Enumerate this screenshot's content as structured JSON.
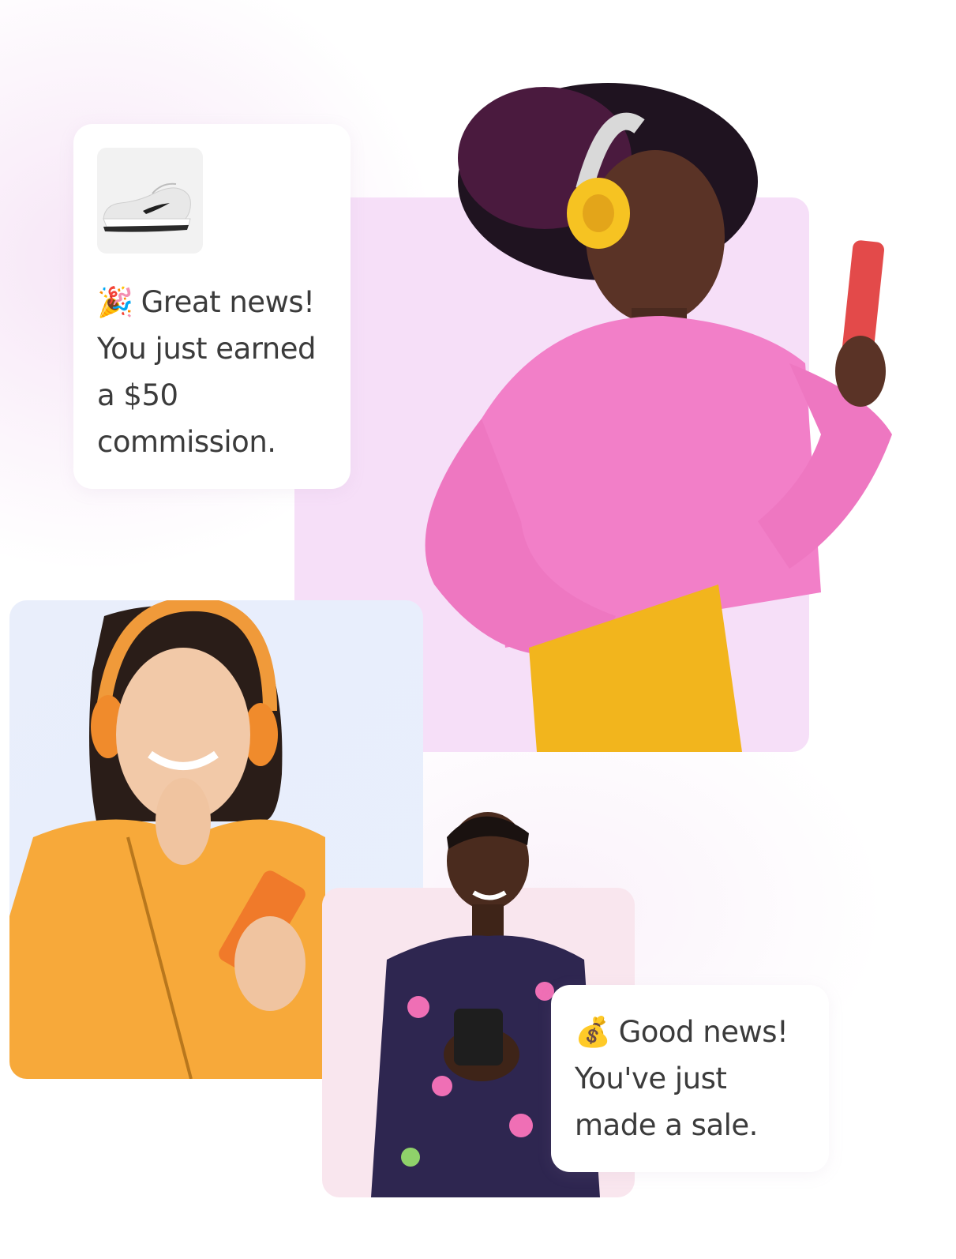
{
  "notifications": {
    "commission": {
      "emoji": "🎉",
      "headline": "Great news!",
      "body_line_1": "You just earned",
      "body_line_2": "a $50",
      "body_line_3": "commission.",
      "product_icon": "sneaker-icon"
    },
    "sale": {
      "emoji": "💰",
      "headline": "Good news!",
      "body_line_1": "You've just",
      "body_line_2": "made a sale."
    }
  },
  "colors": {
    "text": "#3b3b3b",
    "panel_pink": "#f6dff8",
    "panel_blue": "#e9eefb",
    "panel_rose": "#f9e6ee",
    "sweater_pink": "#f27fc8",
    "jacket_orange": "#f7a93a",
    "card_bg": "#ffffff"
  }
}
